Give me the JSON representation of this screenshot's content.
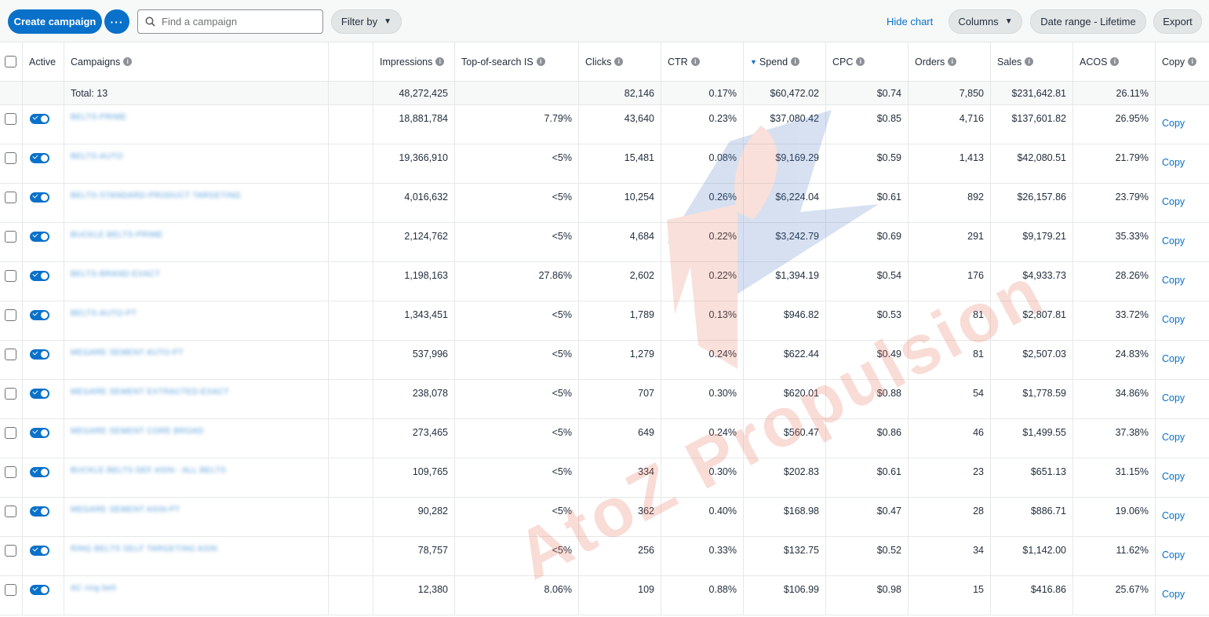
{
  "toolbar": {
    "create_label": "Create campaign",
    "more_label": "···",
    "search_placeholder": "Find a campaign",
    "filter_label": "Filter by",
    "hide_chart_label": "Hide chart",
    "columns_label": "Columns",
    "date_range_label": "Date range - Lifetime",
    "export_label": "Export"
  },
  "headers": {
    "active": "Active",
    "campaigns": "Campaigns",
    "impressions": "Impressions",
    "tos": "Top-of-search IS",
    "clicks": "Clicks",
    "ctr": "CTR",
    "spend": "Spend",
    "cpc": "CPC",
    "orders": "Orders",
    "sales": "Sales",
    "acos": "ACOS",
    "copy": "Copy"
  },
  "totals": {
    "label": "Total: 13",
    "impressions": "48,272,425",
    "clicks": "82,146",
    "ctr": "0.17%",
    "spend": "$60,472.02",
    "cpc": "$0.74",
    "orders": "7,850",
    "sales": "$231,642.81",
    "acos": "26.11%"
  },
  "rows": [
    {
      "name": "BELTS-PRIME",
      "impressions": "18,881,784",
      "tos": "7.79%",
      "clicks": "43,640",
      "ctr": "0.23%",
      "spend": "$37,080.42",
      "cpc": "$0.85",
      "orders": "4,716",
      "sales": "$137,601.82",
      "acos": "26.95%",
      "copy": "Copy"
    },
    {
      "name": "BELTS-AUTO",
      "impressions": "19,366,910",
      "tos": "<5%",
      "clicks": "15,481",
      "ctr": "0.08%",
      "spend": "$9,169.29",
      "cpc": "$0.59",
      "orders": "1,413",
      "sales": "$42,080.51",
      "acos": "21.79%",
      "copy": "Copy"
    },
    {
      "name": "BELTS-STANDARD-PRODUCT TARGETING",
      "impressions": "4,016,632",
      "tos": "<5%",
      "clicks": "10,254",
      "ctr": "0.26%",
      "spend": "$6,224.04",
      "cpc": "$0.61",
      "orders": "892",
      "sales": "$26,157.86",
      "acos": "23.79%",
      "copy": "Copy"
    },
    {
      "name": "BUCKLE BELTS-PRIME",
      "impressions": "2,124,762",
      "tos": "<5%",
      "clicks": "4,684",
      "ctr": "0.22%",
      "spend": "$3,242.79",
      "cpc": "$0.69",
      "orders": "291",
      "sales": "$9,179.21",
      "acos": "35.33%",
      "copy": "Copy"
    },
    {
      "name": "BELTS-BRAND-EXACT",
      "impressions": "1,198,163",
      "tos": "27.86%",
      "clicks": "2,602",
      "ctr": "0.22%",
      "spend": "$1,394.19",
      "cpc": "$0.54",
      "orders": "176",
      "sales": "$4,933.73",
      "acos": "28.26%",
      "copy": "Copy"
    },
    {
      "name": "BELTS-AUTO-PT",
      "impressions": "1,343,451",
      "tos": "<5%",
      "clicks": "1,789",
      "ctr": "0.13%",
      "spend": "$946.82",
      "cpc": "$0.53",
      "orders": "81",
      "sales": "$2,807.81",
      "acos": "33.72%",
      "copy": "Copy"
    },
    {
      "name": "MEGARE SEMENT AUTO-PT",
      "impressions": "537,996",
      "tos": "<5%",
      "clicks": "1,279",
      "ctr": "0.24%",
      "spend": "$622.44",
      "cpc": "$0.49",
      "orders": "81",
      "sales": "$2,507.03",
      "acos": "24.83%",
      "copy": "Copy"
    },
    {
      "name": "MEGARE SEMENT EXTRACTED-EXACT",
      "impressions": "238,078",
      "tos": "<5%",
      "clicks": "707",
      "ctr": "0.30%",
      "spend": "$620.01",
      "cpc": "$0.88",
      "orders": "54",
      "sales": "$1,778.59",
      "acos": "34.86%",
      "copy": "Copy"
    },
    {
      "name": "MEGARE SEMENT CORE BROAD",
      "impressions": "273,465",
      "tos": "<5%",
      "clicks": "649",
      "ctr": "0.24%",
      "spend": "$560.47",
      "cpc": "$0.86",
      "orders": "46",
      "sales": "$1,499.55",
      "acos": "37.38%",
      "copy": "Copy"
    },
    {
      "name": "BUCKLE BELTS DEF ASIN - ALL BELTS",
      "impressions": "109,765",
      "tos": "<5%",
      "clicks": "334",
      "ctr": "0.30%",
      "spend": "$202.83",
      "cpc": "$0.61",
      "orders": "23",
      "sales": "$651.13",
      "acos": "31.15%",
      "copy": "Copy"
    },
    {
      "name": "MEGARE SEMENT ASIN-PT",
      "impressions": "90,282",
      "tos": "<5%",
      "clicks": "362",
      "ctr": "0.40%",
      "spend": "$168.98",
      "cpc": "$0.47",
      "orders": "28",
      "sales": "$886.71",
      "acos": "19.06%",
      "copy": "Copy"
    },
    {
      "name": "RING BELTS SELF TARGETING ASIN",
      "impressions": "78,757",
      "tos": "<5%",
      "clicks": "256",
      "ctr": "0.33%",
      "spend": "$132.75",
      "cpc": "$0.52",
      "orders": "34",
      "sales": "$1,142.00",
      "acos": "11.62%",
      "copy": "Copy"
    },
    {
      "name": "AC ring belt",
      "impressions": "12,380",
      "tos": "8.06%",
      "clicks": "109",
      "ctr": "0.88%",
      "spend": "$106.99",
      "cpc": "$0.98",
      "orders": "15",
      "sales": "$416.86",
      "acos": "25.67%",
      "copy": "Copy"
    }
  ],
  "watermark": {
    "text": "AtoZ Propulsion",
    "logo_letter": "Z",
    "color": "#e8775f",
    "logo_color": "#4a78c0"
  },
  "colors": {
    "accent": "#0971c9"
  }
}
